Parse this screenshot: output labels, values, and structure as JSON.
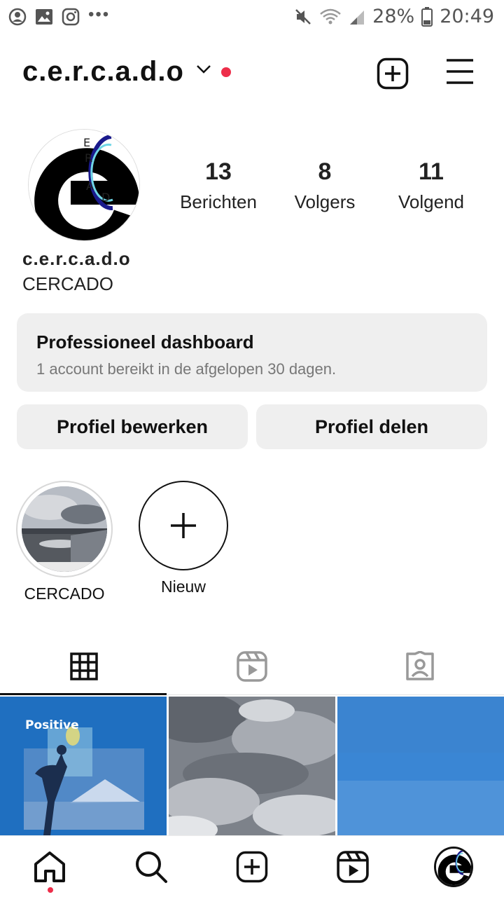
{
  "status_bar": {
    "left_icons": [
      "account-circle-icon",
      "gallery-icon",
      "instagram-icon",
      "more-dots-icon"
    ],
    "right_icons": [
      "mute-icon",
      "wifi-icon",
      "signal-icon",
      "battery-icon"
    ],
    "battery": "28%",
    "time": "20:49"
  },
  "header": {
    "username": "c.e.r.c.a.d.o",
    "icons": [
      "chevron-down-icon",
      "notification-dot",
      "add-post-icon",
      "menu-icon"
    ]
  },
  "profile": {
    "name": "c.e.r.c.a.d.o",
    "bio": "CERCADO",
    "stats": [
      {
        "value": "13",
        "label": "Berichten"
      },
      {
        "value": "8",
        "label": "Volgers"
      },
      {
        "value": "11",
        "label": "Volgend"
      }
    ]
  },
  "dashboard": {
    "title": "Professioneel dashboard",
    "subtitle": "1 account bereikt in de afgelopen 30 dagen."
  },
  "buttons": {
    "edit": "Profiel bewerken",
    "share": "Profiel delen"
  },
  "highlights": [
    {
      "label": "CERCADO"
    },
    {
      "label": "Nieuw"
    }
  ],
  "tabs": [
    "grid-icon",
    "reels-icon",
    "tagged-icon"
  ],
  "posts": [
    {
      "caption": "Positive"
    },
    {
      "caption": ""
    },
    {
      "caption": ""
    }
  ],
  "bottom_nav": [
    "home-icon",
    "search-icon",
    "create-icon",
    "reels-icon",
    "profile-avatar"
  ],
  "colors": {
    "accent_red": "#ed2e4a",
    "button_bg": "#efefef",
    "post1_bg": "#1f6fc0",
    "post3_bg": "#3a86d4"
  }
}
